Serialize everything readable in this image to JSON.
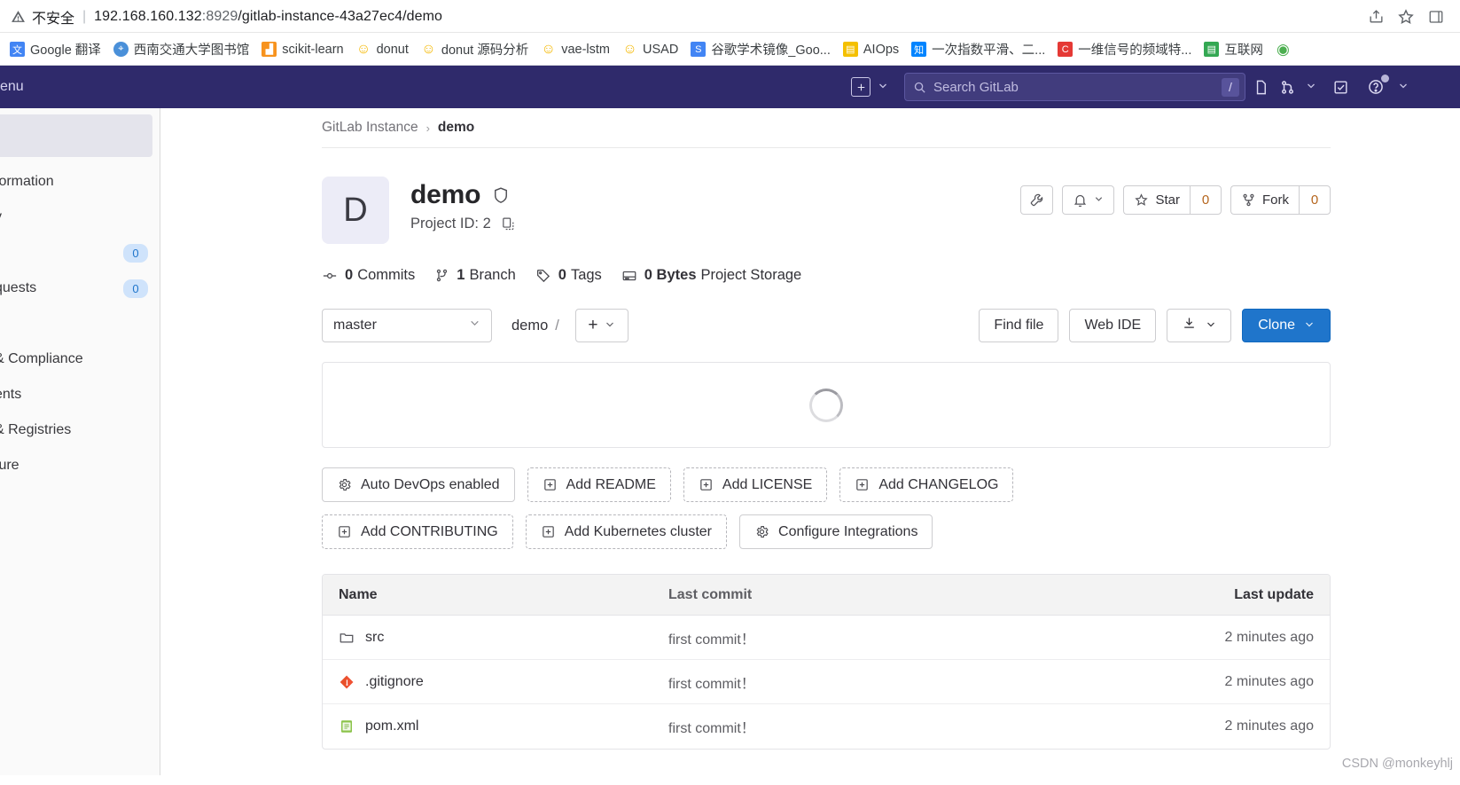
{
  "browser": {
    "security_label": "不安全",
    "url_host": "192.168.160.132",
    "url_port": ":8929",
    "url_path": "/gitlab-instance-43a27ec4/demo",
    "share_icon": "share-icon",
    "star_icon": "bookmark-star-icon",
    "sidepanel_icon": "side-panel-icon",
    "bookmarks": [
      {
        "label": "Google 翻译",
        "icon": "translate-icon",
        "color": "#4285f4"
      },
      {
        "label": "西南交通大学图书馆",
        "icon": "library-icon",
        "color": "#4a90d9"
      },
      {
        "label": "scikit-learn",
        "icon": "scikit-learn-icon",
        "color": "#f7931e"
      },
      {
        "label": "donut",
        "icon": "smiley-icon",
        "color": "#f5c518"
      },
      {
        "label": "donut 源码分析",
        "icon": "smiley-icon",
        "color": "#f5c518"
      },
      {
        "label": "vae-lstm",
        "icon": "smiley-icon",
        "color": "#f5c518"
      },
      {
        "label": "USAD",
        "icon": "smiley-icon",
        "color": "#f5c518"
      },
      {
        "label": "谷歌学术镜像_Goo...",
        "icon": "scholar-icon",
        "color": "#4285f4"
      },
      {
        "label": "AIOps",
        "icon": "book-icon",
        "color": "#f4c000"
      },
      {
        "label": "一次指数平滑、二...",
        "icon": "zhihu-icon",
        "color": "#0084ff"
      },
      {
        "label": "一维信号的频域特...",
        "icon": "csdn-icon",
        "color": "#e53935"
      },
      {
        "label": "互联网",
        "icon": "sheets-icon",
        "color": "#34a853"
      },
      {
        "label": "",
        "icon": "chrome-icon",
        "color": "#4caf50"
      }
    ]
  },
  "navbar": {
    "menu_text": "enu",
    "plus_icon": "plus-square-icon",
    "plus_caret_icon": "chevron-down-icon",
    "search_placeholder": "Search GitLab",
    "search_value": "",
    "search_icon": "search-icon",
    "search_shortcut": "/",
    "issues_icon": "issues-icon",
    "merge_requests_icon": "merge-request-icon",
    "merge_caret_icon": "chevron-down-icon",
    "todos_icon": "todo-check-icon",
    "help_icon": "help-circle-icon",
    "help_caret_icon": "chevron-down-icon"
  },
  "sidebar": {
    "items": [
      {
        "label": "formation",
        "badge": ""
      },
      {
        "label": "y",
        "badge": ""
      },
      {
        "label": "",
        "badge": "0"
      },
      {
        "label": "quests",
        "badge": "0"
      },
      {
        "label": "",
        "badge": ""
      },
      {
        "label": "& Compliance",
        "badge": ""
      },
      {
        "label": "ents",
        "badge": ""
      },
      {
        "label": "& Registries",
        "badge": ""
      },
      {
        "label": "ture",
        "badge": ""
      }
    ]
  },
  "breadcrumb": {
    "root": "GitLab Instance",
    "separator": "›",
    "current": "demo"
  },
  "project": {
    "avatar_letter": "D",
    "name": "demo",
    "visibility_icon": "shield-icon",
    "project_id_label": "Project ID: 2",
    "copy_icon": "copy-clipboard-icon",
    "actions": {
      "settings_icon": "wrench-icon",
      "notifications_icon": "bell-icon",
      "notifications_caret_icon": "chevron-down-icon",
      "star_icon": "star-icon",
      "star_label": "Star",
      "star_count": "0",
      "fork_icon": "fork-icon",
      "fork_label": "Fork",
      "fork_count": "0"
    },
    "stats": [
      {
        "icon": "commit-icon",
        "value": "0",
        "label": "Commits"
      },
      {
        "icon": "branch-icon",
        "value": "1",
        "label": "Branch"
      },
      {
        "icon": "tag-icon",
        "value": "0",
        "label": "Tags"
      },
      {
        "icon": "storage-icon",
        "value": "0 Bytes",
        "label": "Project Storage"
      }
    ]
  },
  "repo_toolbar": {
    "branch": "master",
    "branch_caret_icon": "chevron-down-icon",
    "path_root": "demo",
    "path_separator": "/",
    "add_icon": "plus-icon",
    "add_caret_icon": "chevron-down-icon",
    "find_file_label": "Find file",
    "web_ide_label": "Web IDE",
    "download_icon": "download-icon",
    "download_caret_icon": "chevron-down-icon",
    "clone_label": "Clone",
    "clone_caret_icon": "chevron-down-icon",
    "clone_color": "#1f75cb"
  },
  "loading_panel": {
    "spinner_icon": "loading-spinner-icon"
  },
  "quick_actions": [
    {
      "label": "Auto DevOps enabled",
      "icon": "gear-icon",
      "dashed": false
    },
    {
      "label": "Add README",
      "icon": "plus-square-icon",
      "dashed": true
    },
    {
      "label": "Add LICENSE",
      "icon": "plus-square-icon",
      "dashed": true
    },
    {
      "label": "Add CHANGELOG",
      "icon": "plus-square-icon",
      "dashed": true
    },
    {
      "label": "Add CONTRIBUTING",
      "icon": "plus-square-icon",
      "dashed": true
    },
    {
      "label": "Add Kubernetes cluster",
      "icon": "plus-square-icon",
      "dashed": true
    },
    {
      "label": "Configure Integrations",
      "icon": "gear-icon",
      "dashed": false
    }
  ],
  "file_table": {
    "columns": {
      "name": "Name",
      "last_commit": "Last commit",
      "last_update": "Last update"
    },
    "rows": [
      {
        "name": "src",
        "icon": "folder-icon",
        "last_commit": "first commit！",
        "last_update": "2 minutes ago"
      },
      {
        "name": ".gitignore",
        "icon": "git-icon",
        "last_commit": "first commit！",
        "last_update": "2 minutes ago"
      },
      {
        "name": "pom.xml",
        "icon": "xml-file-icon",
        "last_commit": "first commit！",
        "last_update": "2 minutes ago"
      }
    ]
  },
  "watermark": "CSDN @monkeyhlj"
}
